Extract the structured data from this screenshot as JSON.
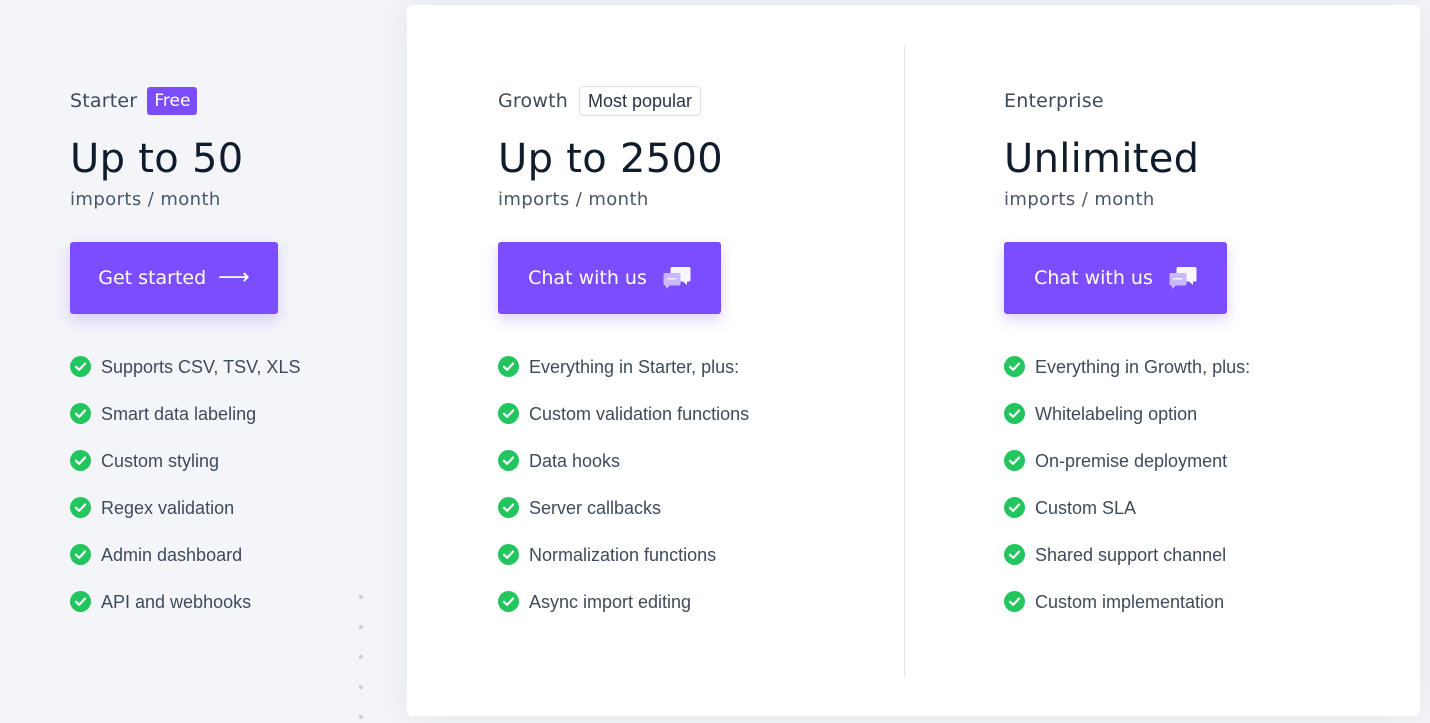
{
  "colors": {
    "accent": "#7c4dff",
    "check": "#22c55e",
    "panel": "#ffffff",
    "background": "#f3f5f9"
  },
  "plans": [
    {
      "name": "Starter",
      "badge": "Free",
      "amount": "Up to 50",
      "unit": "imports / month",
      "cta_label": "Get started",
      "cta_icon": "arrow-right-icon",
      "features": [
        "Supports CSV, TSV, XLS",
        "Smart data labeling",
        "Custom styling",
        "Regex validation",
        "Admin dashboard",
        "API and webhooks"
      ]
    },
    {
      "name": "Growth",
      "badge": "Most popular",
      "amount": "Up to 2500",
      "unit": "imports / month",
      "cta_label": "Chat with us",
      "cta_icon": "chat-bubbles-icon",
      "features": [
        "Everything in Starter, plus:",
        "Custom validation functions",
        "Data hooks",
        "Server callbacks",
        "Normalization functions",
        "Async import editing"
      ]
    },
    {
      "name": "Enterprise",
      "amount": "Unlimited",
      "unit": "imports / month",
      "cta_label": "Chat with us",
      "cta_icon": "chat-bubbles-icon",
      "features": [
        "Everything in Growth, plus:",
        "Whitelabeling option",
        "On-premise deployment",
        "Custom SLA",
        "Shared support channel",
        "Custom implementation"
      ]
    }
  ]
}
